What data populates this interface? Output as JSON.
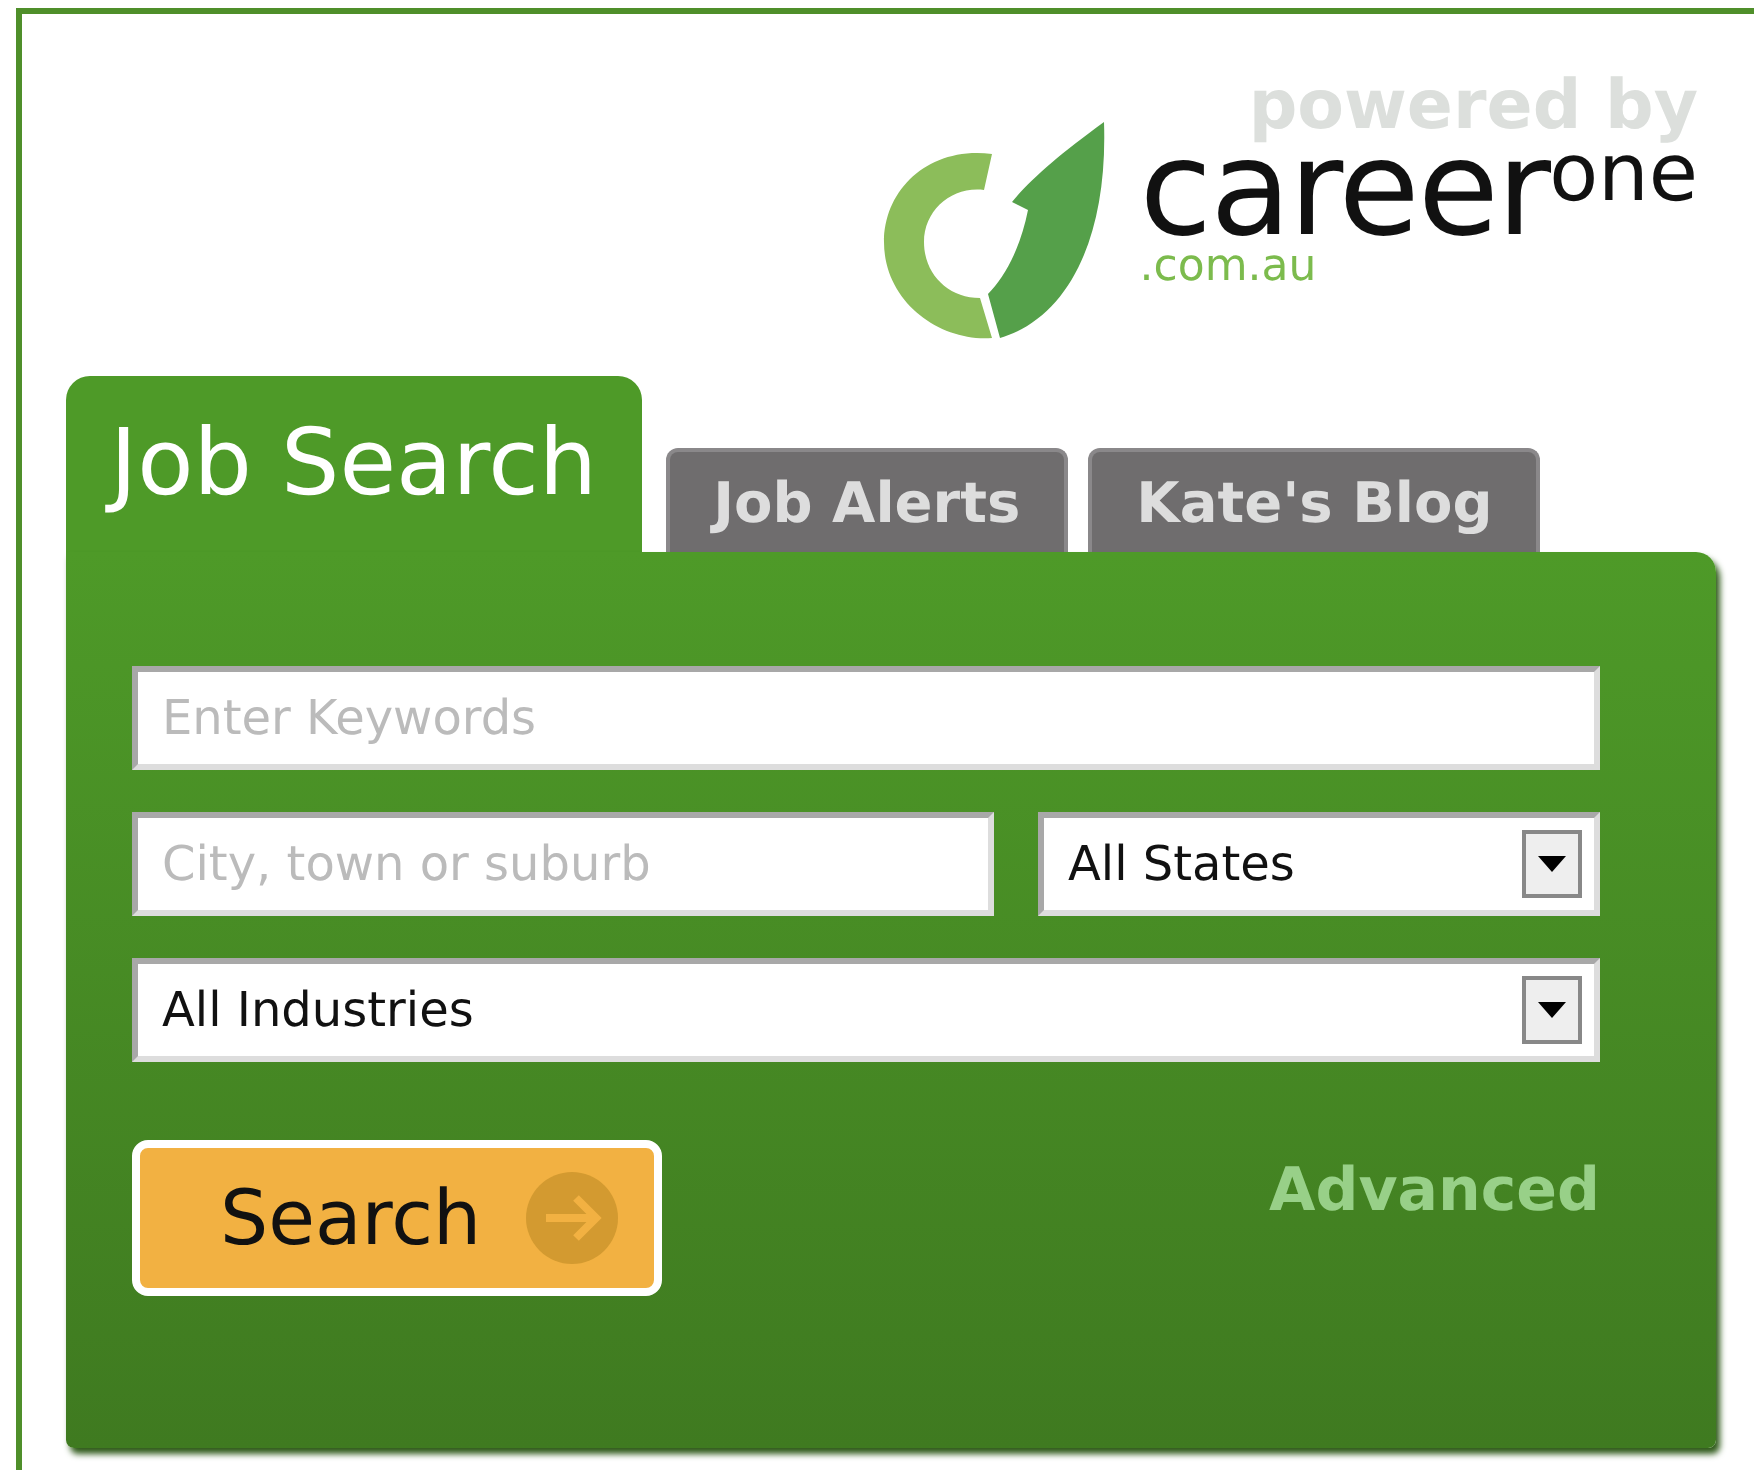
{
  "header": {
    "powered_by": "powered by",
    "logo": {
      "word": "career",
      "suffix": "one",
      "domain": ".com.au"
    }
  },
  "tabs": [
    {
      "label": "Job Search",
      "selected": true
    },
    {
      "label": "Job Alerts",
      "selected": false
    },
    {
      "label": "Kate's Blog",
      "selected": false
    }
  ],
  "form": {
    "keywords": {
      "placeholder": "Enter Keywords"
    },
    "location": {
      "placeholder": "City, town or suburb"
    },
    "state": {
      "value": "All States"
    },
    "industry": {
      "value": "All Industries"
    }
  },
  "search_button": {
    "label": "Search"
  },
  "advanced_link": "Advanced"
}
